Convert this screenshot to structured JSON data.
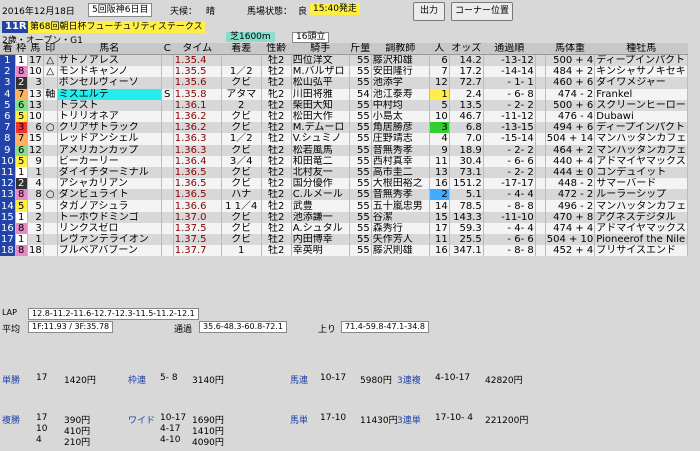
{
  "header": {
    "date": "2016年12月18日",
    "meeting": "5回阪神6日目",
    "weather_label": "天候：",
    "weather": "晴",
    "track_label": "馬場状態：",
    "track": "良",
    "start_time": "15:40発走",
    "print_button": "出力",
    "corner_button": "コーナー位置"
  },
  "race": {
    "number": "11R",
    "name": "第68回朝日杯フューチュリティステークス",
    "condition": "2歳・オープン・G1",
    "course": "芝1600m",
    "runners": "16頭立"
  },
  "columns": [
    "着",
    "枠",
    "馬",
    "印",
    "馬名",
    "C",
    "タイム",
    "着差",
    "性齢",
    "騎手",
    "斤量",
    "調教師",
    "人",
    "オッズ",
    "通過順",
    "",
    "馬体重",
    "種牡馬"
  ],
  "rows": [
    {
      "pos": "1",
      "waku": "1",
      "uma": "17",
      "mark": "△",
      "name": "サトノアレス",
      "c": "",
      "time": "1.35.4",
      "margin": "",
      "sex": "牡2",
      "jockey": "四位洋文",
      "kin": "55",
      "trainer": "藤沢和雄",
      "pop": "6",
      "odds": "14.2",
      "pass": "-13-12",
      "weight": "500 + 4",
      "sire": "ディープインパクト",
      "wc": "#ffffff"
    },
    {
      "pos": "2",
      "waku": "8",
      "uma": "10",
      "mark": "△",
      "name": "モンドキャンノ",
      "c": "",
      "time": "1.35.5",
      "margin": "1／2",
      "sex": "牡2",
      "jockey": "M.バルザロ",
      "kin": "55",
      "trainer": "安田隆行",
      "pop": "7",
      "odds": "17.2",
      "pass": "-14-14",
      "weight": "484 + 2",
      "sire": "キンシャサノキセキ",
      "wc": "#e888c8"
    },
    {
      "pos": "3",
      "waku": "2",
      "uma": "3",
      "mark": "",
      "name": "ボンセルヴィーソ",
      "c": "",
      "time": "1.35.6",
      "margin": "クビ",
      "sex": "牡2",
      "jockey": "松山弘平",
      "kin": "55",
      "trainer": "池添学",
      "pop": "12",
      "odds": "72.7",
      "pass": "- 1- 1",
      "weight": "460 + 6",
      "sire": "ダイワメジャー",
      "wc": "#333333"
    },
    {
      "pos": "4",
      "waku": "7",
      "uma": "13",
      "mark": "軸",
      "name": "ミスエルテ",
      "c": "S",
      "time": "1.35.8",
      "margin": "アタマ",
      "sex": "牝2",
      "jockey": "川田将雅",
      "kin": "54",
      "trainer": "池江泰寿",
      "pop": "1",
      "odds": "2.4",
      "pass": "- 6- 8",
      "weight": "474 - 2",
      "sire": "Frankel",
      "wc": "#ffb060",
      "hl": "name"
    },
    {
      "pos": "5",
      "waku": "6",
      "uma": "13",
      "mark": "",
      "name": "トラスト",
      "c": "",
      "time": "1.36.1",
      "margin": "2",
      "sex": "牡2",
      "jockey": "柴田大知",
      "kin": "55",
      "trainer": "中村均",
      "pop": "5",
      "odds": "13.5",
      "pass": "- 2- 2",
      "weight": "500 + 6",
      "sire": "スクリーンヒーロー",
      "wc": "#88dd88"
    },
    {
      "pos": "6",
      "waku": "5",
      "uma": "10",
      "mark": "",
      "name": "トリリオネア",
      "c": "",
      "time": "1.36.2",
      "margin": "クビ",
      "sex": "牡2",
      "jockey": "松田大作",
      "kin": "55",
      "trainer": "小島太",
      "pop": "10",
      "odds": "46.7",
      "pass": "-11-12",
      "weight": "476 - 4",
      "sire": "Dubawi",
      "wc": "#44aaff"
    },
    {
      "pos": "7",
      "waku": "3",
      "uma": "6",
      "mark": "○",
      "name": "クリアザトラック",
      "c": "",
      "time": "1.36.2",
      "margin": "クビ",
      "sex": "牡2",
      "jockey": "M.デムーロ",
      "kin": "55",
      "trainer": "角居勝彦",
      "pop": "3",
      "odds": "6.8",
      "pass": "-13-15",
      "weight": "494 + 6",
      "sire": "ディープインパクト",
      "wc": "#ee3333",
      "hl": "pop"
    },
    {
      "pos": "8",
      "waku": "7",
      "uma": "15",
      "mark": "",
      "name": "レッドアンシェル",
      "c": "",
      "time": "1.36.3",
      "margin": "1／2",
      "sex": "牡2",
      "jockey": "V.シュミノ",
      "kin": "55",
      "trainer": "庄野靖志",
      "pop": "4",
      "odds": "7.0",
      "pass": "-15-14",
      "weight": "504 + 14",
      "sire": "マンハッタンカフェ",
      "wc": "#ffb060"
    },
    {
      "pos": "9",
      "waku": "6",
      "uma": "12",
      "mark": "",
      "name": "アメリカンカップ",
      "c": "",
      "time": "1.36.3",
      "margin": "クビ",
      "sex": "牡2",
      "jockey": "松若風馬",
      "kin": "55",
      "trainer": "音無秀孝",
      "pop": "9",
      "odds": "18.9",
      "pass": "- 2- 2",
      "weight": "464 + 2",
      "sire": "マンハッタンカフェ",
      "wc": "#88dd88"
    },
    {
      "pos": "10",
      "waku": "5",
      "uma": "9",
      "mark": "",
      "name": "ビーカーリー",
      "c": "",
      "time": "1.36.4",
      "margin": "3／4",
      "sex": "牡2",
      "jockey": "和田竜二",
      "kin": "55",
      "trainer": "西村真幸",
      "pop": "11",
      "odds": "30.4",
      "pass": "- 6- 6",
      "weight": "440 + 4",
      "sire": "アドマイヤマックス",
      "wc": "#44aaff"
    },
    {
      "pos": "11",
      "waku": "1",
      "uma": "1",
      "mark": "",
      "name": "ダイイチターミナル",
      "c": "",
      "time": "1.36.5",
      "margin": "クビ",
      "sex": "牡2",
      "jockey": "北村友一",
      "kin": "55",
      "trainer": "高市圭二",
      "pop": "13",
      "odds": "73.1",
      "pass": "- 2- 2",
      "weight": "444 ± 0",
      "sire": "コンデュイット",
      "wc": "#ffffff"
    },
    {
      "pos": "12",
      "waku": "2",
      "uma": "4",
      "mark": "",
      "name": "アシャカリアン",
      "c": "",
      "time": "1.36.5",
      "margin": "クビ",
      "sex": "牡2",
      "jockey": "国分優作",
      "kin": "55",
      "trainer": "大根田裕之",
      "pop": "16",
      "odds": "151.2",
      "pass": "-17-17",
      "weight": "448 - 2",
      "sire": "サマーバード",
      "wc": "#333333"
    },
    {
      "pos": "13",
      "waku": "8",
      "uma": "8",
      "mark": "○",
      "name": "ダンビュライト",
      "c": "",
      "time": "1.36.5",
      "margin": "ハナ",
      "sex": "牡2",
      "jockey": "C.ルメール",
      "kin": "55",
      "trainer": "音無秀孝",
      "pop": "2",
      "odds": "5.1",
      "pass": "- 4- 4",
      "weight": "472 - 2",
      "sire": "ルーラーシップ",
      "wc": "#e888c8",
      "hl": "pop2"
    },
    {
      "pos": "14",
      "waku": "5",
      "uma": "5",
      "mark": "",
      "name": "タガノアシュラ",
      "c": "",
      "time": "1.36.6",
      "margin": "1 1／4",
      "sex": "牡2",
      "jockey": "武豊",
      "kin": "55",
      "trainer": "五十嵐忠男",
      "pop": "14",
      "odds": "78.5",
      "pass": "- 8- 8",
      "weight": "496 - 2",
      "sire": "マンハッタンカフェ",
      "wc": "#44aaff"
    },
    {
      "pos": "15",
      "waku": "1",
      "uma": "2",
      "mark": "",
      "name": "トーホウドミンゴ",
      "c": "",
      "time": "1.37.0",
      "margin": "クビ",
      "sex": "牡2",
      "jockey": "池添謙一",
      "kin": "55",
      "trainer": "谷潔",
      "pop": "15",
      "odds": "143.3",
      "pass": "-11-10",
      "weight": "470 + 8",
      "sire": "アグネスデジタル",
      "wc": "#ffffff"
    },
    {
      "pos": "16",
      "waku": "8",
      "uma": "3",
      "mark": "",
      "name": "リンクスゼロ",
      "c": "",
      "time": "1.37.5",
      "margin": "クビ",
      "sex": "牡2",
      "jockey": "A.シュタル",
      "kin": "55",
      "trainer": "森秀行",
      "pop": "17",
      "odds": "59.3",
      "pass": "- 4- 4",
      "weight": "474 + 4",
      "sire": "アドマイヤマックス",
      "wc": "#e888c8"
    },
    {
      "pos": "17",
      "waku": "1",
      "uma": "1",
      "mark": "",
      "name": "レヴァンテライオン",
      "c": "",
      "time": "1.37.5",
      "margin": "クビ",
      "sex": "牡2",
      "jockey": "内田博幸",
      "kin": "55",
      "trainer": "矢作芳人",
      "pop": "11",
      "odds": "25.5",
      "pass": "- 6- 6",
      "weight": "504 + 10",
      "sire": "Pioneerof the Nile",
      "wc": "#ffffff"
    },
    {
      "pos": "18",
      "waku": "8",
      "uma": "18",
      "mark": "",
      "name": "ブルベアバブーン",
      "c": "",
      "time": "1.37.7",
      "margin": "1",
      "sex": "牡2",
      "jockey": "幸英明",
      "kin": "55",
      "trainer": "藤沢則雄",
      "pop": "16",
      "odds": "347.1",
      "pass": "- 8- 8",
      "weight": "452 + 4",
      "sire": "ブリサイスエンド",
      "wc": "#e888c8"
    }
  ],
  "lap": {
    "label": "LAP",
    "values": "12.8-11.2-11.6-12.7-12.3-11.5-11.2-12.1",
    "avg_label": "平均",
    "avg": "1F:11.93 / 3F:35.78",
    "pass_label": "通過",
    "pass": "35.6-48.3-60.8-72.1",
    "up_label": "上り",
    "up": "71.4-59.8-47.1-34.8"
  },
  "payouts": [
    {
      "type": "単勝",
      "combo": "17",
      "amount": "1420円",
      "type2": "枠連",
      "combo2": "5- 8",
      "amount2": "3140円",
      "type3": "馬連",
      "combo3": "10-17",
      "amount3": "5980円",
      "type4": "3連複",
      "combo4": "4-10-17",
      "amount4": "42820円"
    },
    {
      "type": "複勝",
      "combo": "17",
      "amount": "390円",
      "type2": "ワイド",
      "combo2": "10-17",
      "amount2": "1690円",
      "type3": "馬単",
      "combo3": "17-10",
      "amount3": "11430円",
      "type4": "3連単",
      "combo4": "17-10- 4",
      "amount4": "221200円"
    },
    {
      "type": "",
      "combo": "10",
      "amount": "410円",
      "type2": "",
      "combo2": "4-17",
      "amount2": "1410円",
      "type3": "",
      "combo3": "",
      "amount3": "",
      "type4": "",
      "combo4": "",
      "amount4": ""
    },
    {
      "type": "",
      "combo": "4",
      "amount": "210円",
      "type2": "",
      "combo2": "4-10",
      "amount2": "4090円",
      "type3": "",
      "combo3": "",
      "amount3": "",
      "type4": "",
      "combo4": "",
      "amount4": ""
    }
  ],
  "colors": {
    "waku": [
      "#ffffff",
      "#333333",
      "#ee3333",
      "#44aaff",
      "#ffee44",
      "#88dd88",
      "#ffb060",
      "#e888c8"
    ]
  }
}
